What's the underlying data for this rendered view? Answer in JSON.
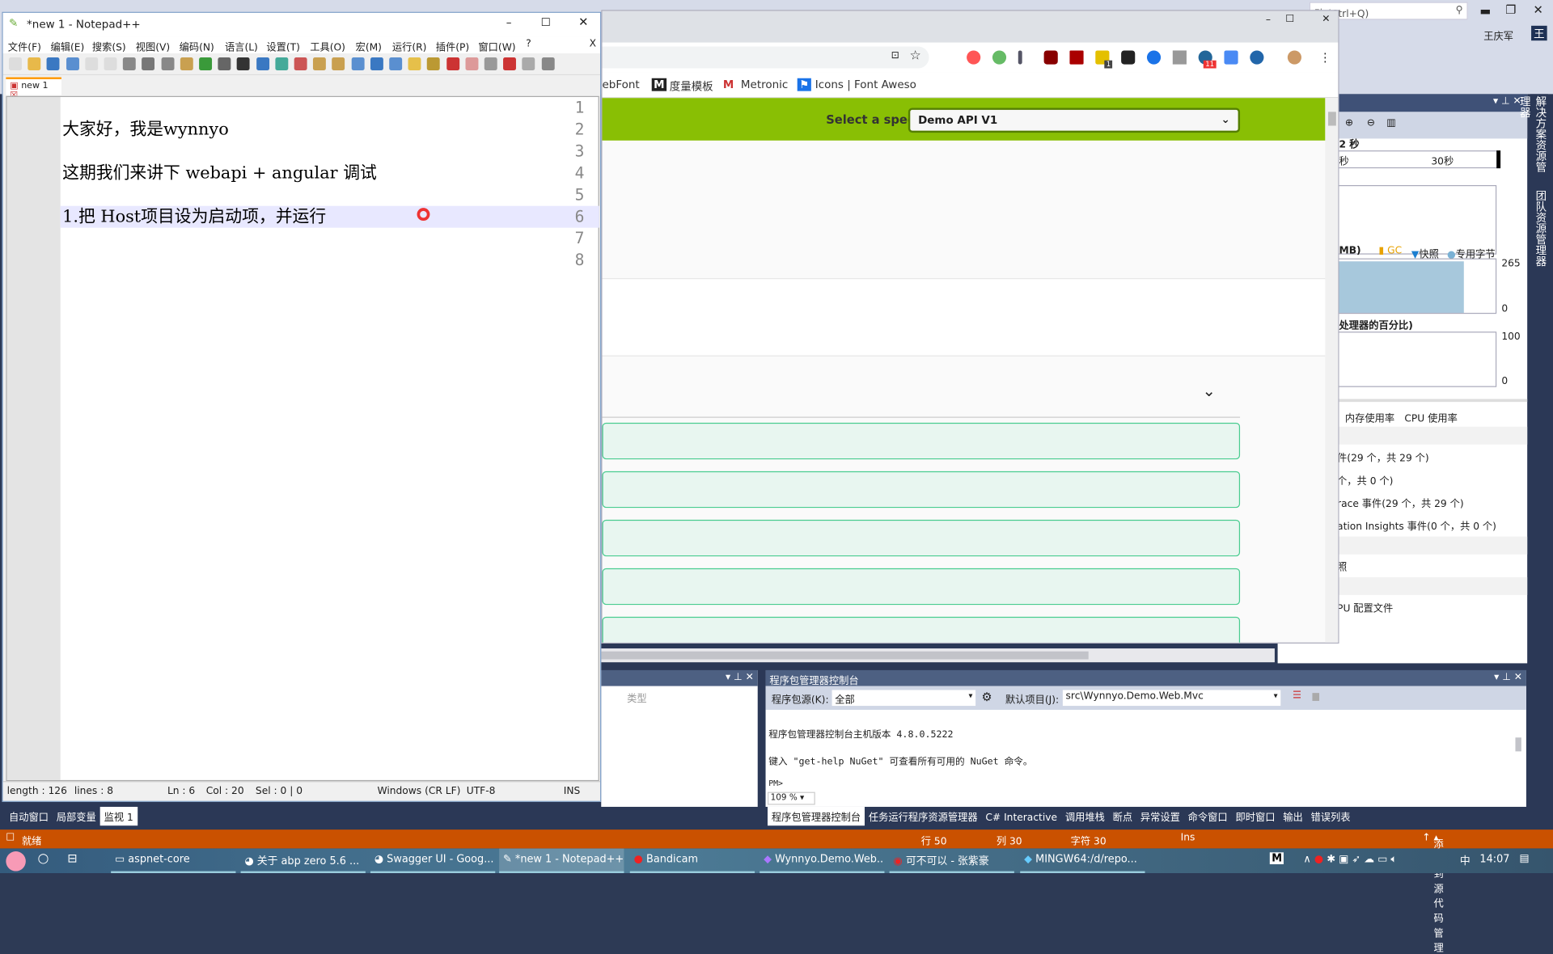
{
  "vs": {
    "quick_launch": "动 (Ctrl+Q)",
    "user": "王庆军",
    "avatar_letter": "王",
    "right_tabs": [
      "解决方案资源管理器",
      "团队资源管理器"
    ],
    "diag": {
      "time": "2 秒",
      "tick": "30秒",
      "tick_left": "秒",
      "mem_title": "MB)",
      "legend": [
        "GC",
        "快照",
        "专用字节"
      ],
      "mem_max": "265",
      "mem_min": "0",
      "cpu_title": "处理器的百分比)",
      "cpu_max": "100",
      "cpu_min": "0",
      "tabs": [
        "内存使用率",
        "CPU 使用率"
      ],
      "events": [
        "件(29 个，共 29 个)",
        "个，共 0 个)",
        "race 事件(29 个，共 29 个)",
        "ation Insights 事件(0 个，共 0 个)"
      ],
      "snapshot": "照",
      "cpu_profile": "PU 配置文件",
      "memory_fill_pct": 80
    },
    "left_panel": {
      "col_type": "类型"
    },
    "pmc": {
      "title": "程序包管理器控制台",
      "source_label": "程序包源(K):",
      "source_value": "全部",
      "project_label": "默认项目(J):",
      "project_value": "src\\Wynnyo.Demo.Web.Mvc",
      "lines": [
        "程序包管理器控制台主机版本 4.8.0.5222",
        "键入 \"get-help NuGet\" 可查看所有可用的 NuGet 命令。",
        "PM>"
      ],
      "zoom": "109 %"
    },
    "bottom_tabs_left": [
      "自动窗口",
      "局部变量",
      "监视 1"
    ],
    "bottom_tabs_right": [
      "程序包管理器控制台",
      "任务运行程序资源管理器",
      "C# Interactive",
      "调用堆栈",
      "断点",
      "异常设置",
      "命令窗口",
      "即时窗口",
      "输出",
      "错误列表"
    ],
    "status": {
      "ready": "就绪",
      "row": "行 50",
      "col": "列 30",
      "char": "字符 30",
      "ins": "Ins",
      "source_control": "添加到源代码管理"
    }
  },
  "chrome": {
    "bookmarks": [
      "ebFont",
      "度量模板",
      "Metronic",
      "Icons | Font Aweso"
    ],
    "ext_badges": [
      "1",
      "11"
    ],
    "swagger": {
      "label": "Select a spec",
      "spec": "Demo API V1",
      "color": "#89bf04"
    }
  },
  "npp": {
    "title": "*new 1 - Notepad++",
    "menu": [
      "文件(F)",
      "编辑(E)",
      "搜索(S)",
      "视图(V)",
      "编码(N)",
      "语言(L)",
      "设置(T)",
      "工具(O)",
      "宏(M)",
      "运行(R)",
      "插件(P)",
      "窗口(W)",
      "?"
    ],
    "close_doc": "X",
    "tab": "new 1",
    "lines": [
      "",
      "大家好，我是wynnyo",
      "",
      "这期我们来讲下 webapi + angular 调试",
      "",
      "1.把 Host项目设为启动项，并运行",
      "",
      ""
    ],
    "line_numbers": [
      "1",
      "2",
      "3",
      "4",
      "5",
      "6",
      "7",
      "8"
    ],
    "status": {
      "length": "length : 126",
      "lines": "lines : 8",
      "ln": "Ln : 6",
      "col": "Col : 20",
      "sel": "Sel : 0 | 0",
      "eol": "Windows (CR LF)",
      "enc": "UTF-8",
      "mode": "INS"
    }
  },
  "taskbar": {
    "items": [
      "aspnet-core",
      "关于 abp zero 5.6 ...",
      "Swagger UI - Goog...",
      "*new 1 - Notepad++",
      "Bandicam",
      "Wynnyo.Demo.Web...",
      "可不可以 - 张紫豪",
      "MINGW64:/d/repo..."
    ],
    "ime": "中",
    "clock": "14:07"
  }
}
